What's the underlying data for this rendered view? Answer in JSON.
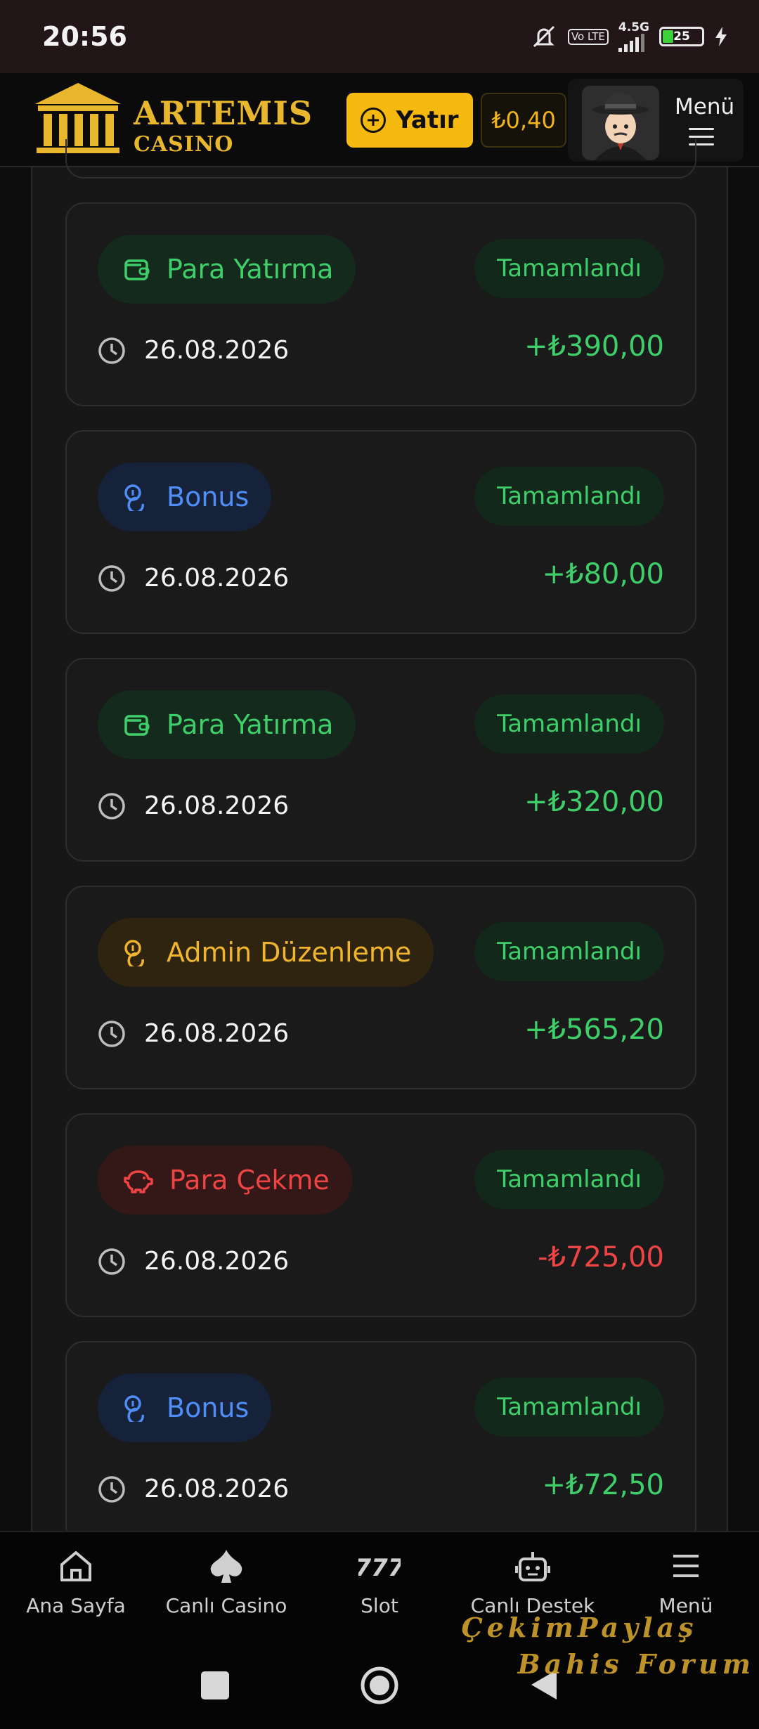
{
  "status_bar": {
    "time": "20:56",
    "network": "4.5G",
    "volte": "Vo LTE",
    "battery": "25"
  },
  "header": {
    "brand_title": "ARTEMIS",
    "brand_sub": "CASINO",
    "deposit_label": "Yatır",
    "balance": "₺0,40",
    "menu_label": "Menü"
  },
  "transactions": [
    {
      "type": "Para Yatırma",
      "status": "Tamamlandı",
      "date": "26.08.2026",
      "amount": "+₺390,00"
    },
    {
      "type": "Bonus",
      "status": "Tamamlandı",
      "date": "26.08.2026",
      "amount": "+₺80,00"
    },
    {
      "type": "Para Yatırma",
      "status": "Tamamlandı",
      "date": "26.08.2026",
      "amount": "+₺320,00"
    },
    {
      "type": "Admin Düzenleme",
      "status": "Tamamlandı",
      "date": "26.08.2026",
      "amount": "+₺565,20"
    },
    {
      "type": "Para Çekme",
      "status": "Tamamlandı",
      "date": "26.08.2026",
      "amount": "-₺725,00"
    },
    {
      "type": "Bonus",
      "status": "Tamamlandı",
      "date": "26.08.2026",
      "amount": "+₺72,50"
    }
  ],
  "bottom_nav": [
    {
      "label": "Ana Sayfa",
      "icon": "home-icon"
    },
    {
      "label": "Canlı Casino",
      "icon": "spade-icon"
    },
    {
      "label": "Slot",
      "icon": "slot-777-icon"
    },
    {
      "label": "Canlı Destek",
      "icon": "robot-support-icon"
    },
    {
      "label": "Menü",
      "icon": "menu-icon"
    }
  ],
  "watermark": {
    "line1": "ÇekimPaylaş",
    "line2": "Bahis Forum"
  },
  "colors": {
    "accent": "#f6b90f",
    "green": "#3ecf6a",
    "red": "#ef4444",
    "blue": "#4f8ef7",
    "gold": "#e9b72d"
  }
}
